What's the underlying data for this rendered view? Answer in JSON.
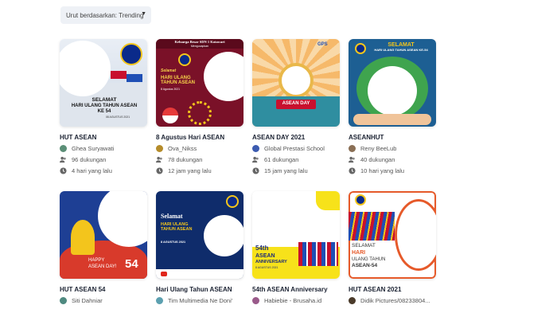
{
  "sort": {
    "label": "Urut berdasarkan: Trending"
  },
  "cards": [
    {
      "title": "HUT ASEAN",
      "author": "Ghea Suryawati",
      "support": "96 dukungan",
      "time": "4 hari yang lalu",
      "art": {
        "line1": "SELAMAT",
        "line2": "HARI ULANG TAHUN ASEAN",
        "line3": "KE 54",
        "line4": "08 AGUSTUS 2021"
      }
    },
    {
      "title": "8 Agustus Hari ASEAN",
      "author": "Ova_Nikss",
      "support": "78 dukungan",
      "time": "12 jam yang lalu",
      "art": {
        "line1": "Keluarga Besar SDN 1 Kotawari",
        "line2": "Mengucapkan",
        "line3": "Selamat",
        "line4": "HARI ULANG TAHUN ASEAN",
        "line5": "8 Agustus 2021"
      }
    },
    {
      "title": "ASEAN DAY 2021",
      "author": "Global Prestasi School",
      "support": "61 dukungan",
      "time": "15 jam yang lalu",
      "art": {
        "line1": "GPS",
        "line2": "ASEAN DAY"
      }
    },
    {
      "title": "ASEANHUT",
      "author": "Reny BeeLub",
      "support": "40 dukungan",
      "time": "10 hari yang lalu",
      "art": {
        "line1": "SELAMAT",
        "line2": "HARI ULANG TAHUN ASEAN KE-54"
      }
    },
    {
      "title": "HUT ASEAN 54",
      "author": "Siti Dahniar",
      "art": {
        "line1": "HAPPY",
        "line2": "ASEAN DAY!",
        "line3": "54"
      }
    },
    {
      "title": "Hari Ulang Tahun ASEAN",
      "author": "Tim Multimedia Ne Doni'",
      "art": {
        "line1": "Selamat",
        "line2": "HARI ULANG TAHUN ASEAN",
        "line3": "8 AGUSTUS 2021"
      }
    },
    {
      "title": "54th ASEAN Anniversary",
      "author": "Habiebie - Brusaha.id",
      "art": {
        "line1": "54th",
        "line2": "ASEAN",
        "line3": "ANNIVERSARY",
        "line4": "8 AGUSTUS 2021"
      }
    },
    {
      "title": "HUT ASEAN 2021",
      "author": "Didik Pictures/08233804...",
      "art": {
        "line1": "SELAMAT",
        "line2": "HARI",
        "line3": "ULANG TAHUN",
        "line4": "ASEAN-54"
      }
    }
  ]
}
